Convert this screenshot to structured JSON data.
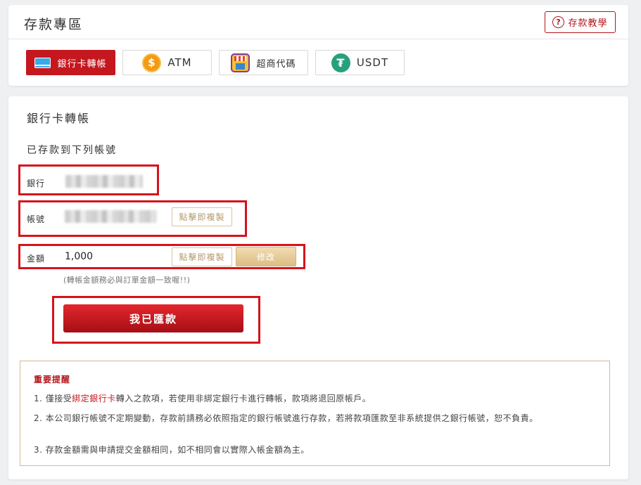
{
  "header": {
    "title": "存款專區",
    "tutorial_label": "存款教學"
  },
  "methods": [
    {
      "label": "銀行卡轉帳",
      "icon": "bank-card-icon",
      "active": true
    },
    {
      "label": "ATM",
      "icon": "dollar-coin-icon",
      "active": false
    },
    {
      "label": "超商代碼",
      "icon": "convenience-store-icon",
      "active": false
    },
    {
      "label": "USDT",
      "icon": "tether-icon",
      "active": false
    }
  ],
  "section": {
    "title": "銀行卡轉帳",
    "deposit_note": "已存款到下列帳號"
  },
  "fields": {
    "bank_label": "銀行",
    "account_label": "帳號",
    "amount_label": "金額",
    "amount_value": "1,000",
    "copy_label": "點擊即複製",
    "edit_label": "修改",
    "hint": "(轉帳金額務必與訂單金額一致喔!!)"
  },
  "submit_label": "我已匯款",
  "notice": {
    "title": "重要提醒",
    "item1_prefix": "1. 僅接受",
    "item1_em": "綁定銀行卡",
    "item1_suffix": "轉入之款項，若使用非綁定銀行卡進行轉帳，款項將退回原帳戶。",
    "item2": "2. 本公司銀行帳號不定期變動，存款前請務必依照指定的銀行帳號進行存款，若將款項匯款至非系統提供之銀行帳號，恕不負責。",
    "item3": "3. 存款金額需與申請提交金額相同，如不相同會以實際入帳金額為主。"
  },
  "colors": {
    "brand_red": "#c4171e",
    "gold": "#dcbd85",
    "highlight_box": "#d6121b"
  }
}
